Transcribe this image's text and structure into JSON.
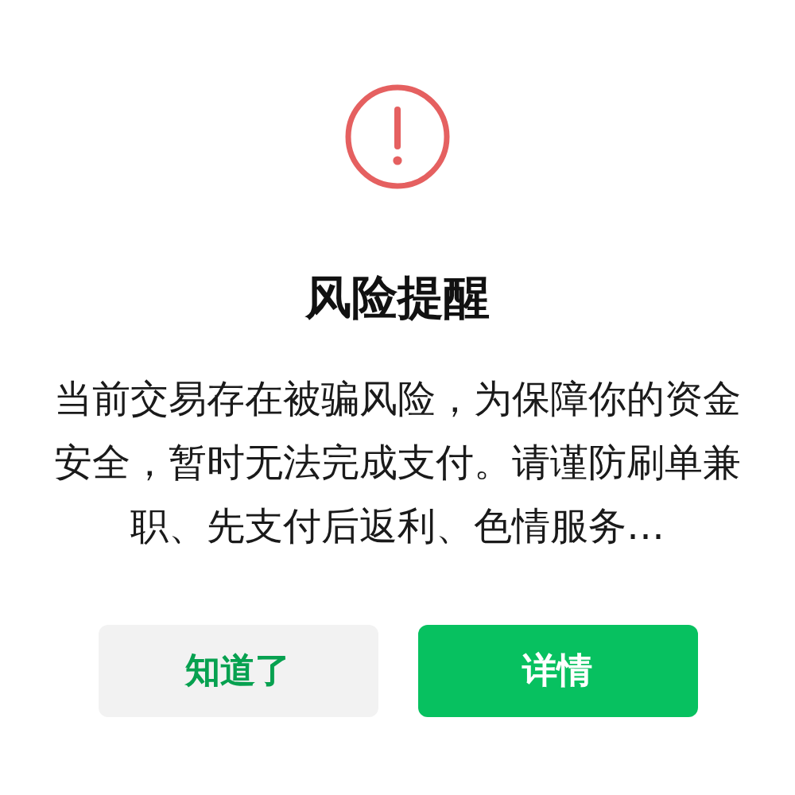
{
  "dialog": {
    "title": "风险提醒",
    "message": "当前交易存在被骗风险，为保障你的资金安全，暂时无法完成支付。请谨防刷单兼职、先支付后返利、色情服务…",
    "buttons": [
      {
        "label": "知道了",
        "kind": "secondary"
      },
      {
        "label": "详情",
        "kind": "primary"
      }
    ]
  }
}
